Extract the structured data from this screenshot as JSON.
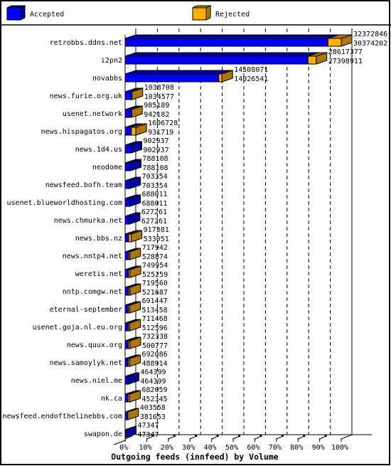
{
  "legend": {
    "items": [
      {
        "label": "Accepted",
        "color": "#0000ff",
        "dark": "#0000a0"
      },
      {
        "label": "Rejected",
        "color": "#ffb000",
        "dark": "#b07800"
      }
    ]
  },
  "chart_data": {
    "type": "bar",
    "orientation": "horizontal",
    "stacked": true,
    "style": "3d",
    "title": "Outgoing feeds (innfeed) by Volume",
    "xlabel": "",
    "ylabel": "",
    "xlim": [
      0,
      100
    ],
    "x_unit": "% of largest feed total",
    "grid": true,
    "legend_position": "top",
    "xaxis_ticks": [
      "0%",
      "10%",
      "20%",
      "30%",
      "40%",
      "50%",
      "60%",
      "70%",
      "80%",
      "90%",
      "100%"
    ],
    "categories": [
      "retrobbs.ddns.net",
      "i2pn2",
      "novabbs",
      "news.furie.org.uk",
      "usenet.network",
      "news.hispagatos.org",
      "news.1d4.us",
      "neodome",
      "newsfeed.bofh.team",
      "usenet.blueworldhosting.com",
      "news.chmurka.net",
      "news.bbs.nz",
      "news.nntp4.net",
      "weretis.net",
      "nntp.comgw.net",
      "eternal-september",
      "usenet.goja.nl.eu.org",
      "news.quux.org",
      "news.samoylyk.net",
      "news.niel.me",
      "nk.ca",
      "newsfeed.endofthelinebbs.com",
      "swapon.de"
    ],
    "series": [
      {
        "name": "Accepted",
        "color": "#0000ff",
        "values": [
          30374202,
          27398911,
          14026541,
          1034577,
          942182,
          931719,
          902937,
          788108,
          703354,
          688011,
          627261,
          533051,
          528874,
          525259,
          521687,
          513458,
          512596,
          500777,
          488914,
          464399,
          452345,
          381653,
          47347
        ]
      },
      {
        "name": "Rejected",
        "color": "#ffb000",
        "values": [
          1998644,
          1218466,
          481530,
          4131,
          43007,
          675009,
          0,
          0,
          0,
          0,
          0,
          384330,
          189068,
          224695,
          197873,
          177989,
          198872,
          231561,
          203172,
          0,
          229714,
          21905,
          0
        ]
      }
    ],
    "value_labels": {
      "top": [
        "32372846",
        "28617377",
        "14508071",
        "1038708",
        "985189",
        "1606728",
        "902937",
        "788108",
        "703354",
        "688011",
        "627261",
        "917381",
        "717942",
        "749954",
        "719560",
        "691447",
        "711468",
        "732338",
        "692086",
        "464399",
        "682059",
        "403558",
        "47347"
      ],
      "bottom": [
        "30374202",
        "27398911",
        "14026541",
        "1034577",
        "942182",
        "931719",
        "902937",
        "788108",
        "703354",
        "688011",
        "627261",
        "533051",
        "528874",
        "525259",
        "521687",
        "513458",
        "512596",
        "500777",
        "488914",
        "464399",
        "452345",
        "381653",
        "47347"
      ]
    }
  }
}
